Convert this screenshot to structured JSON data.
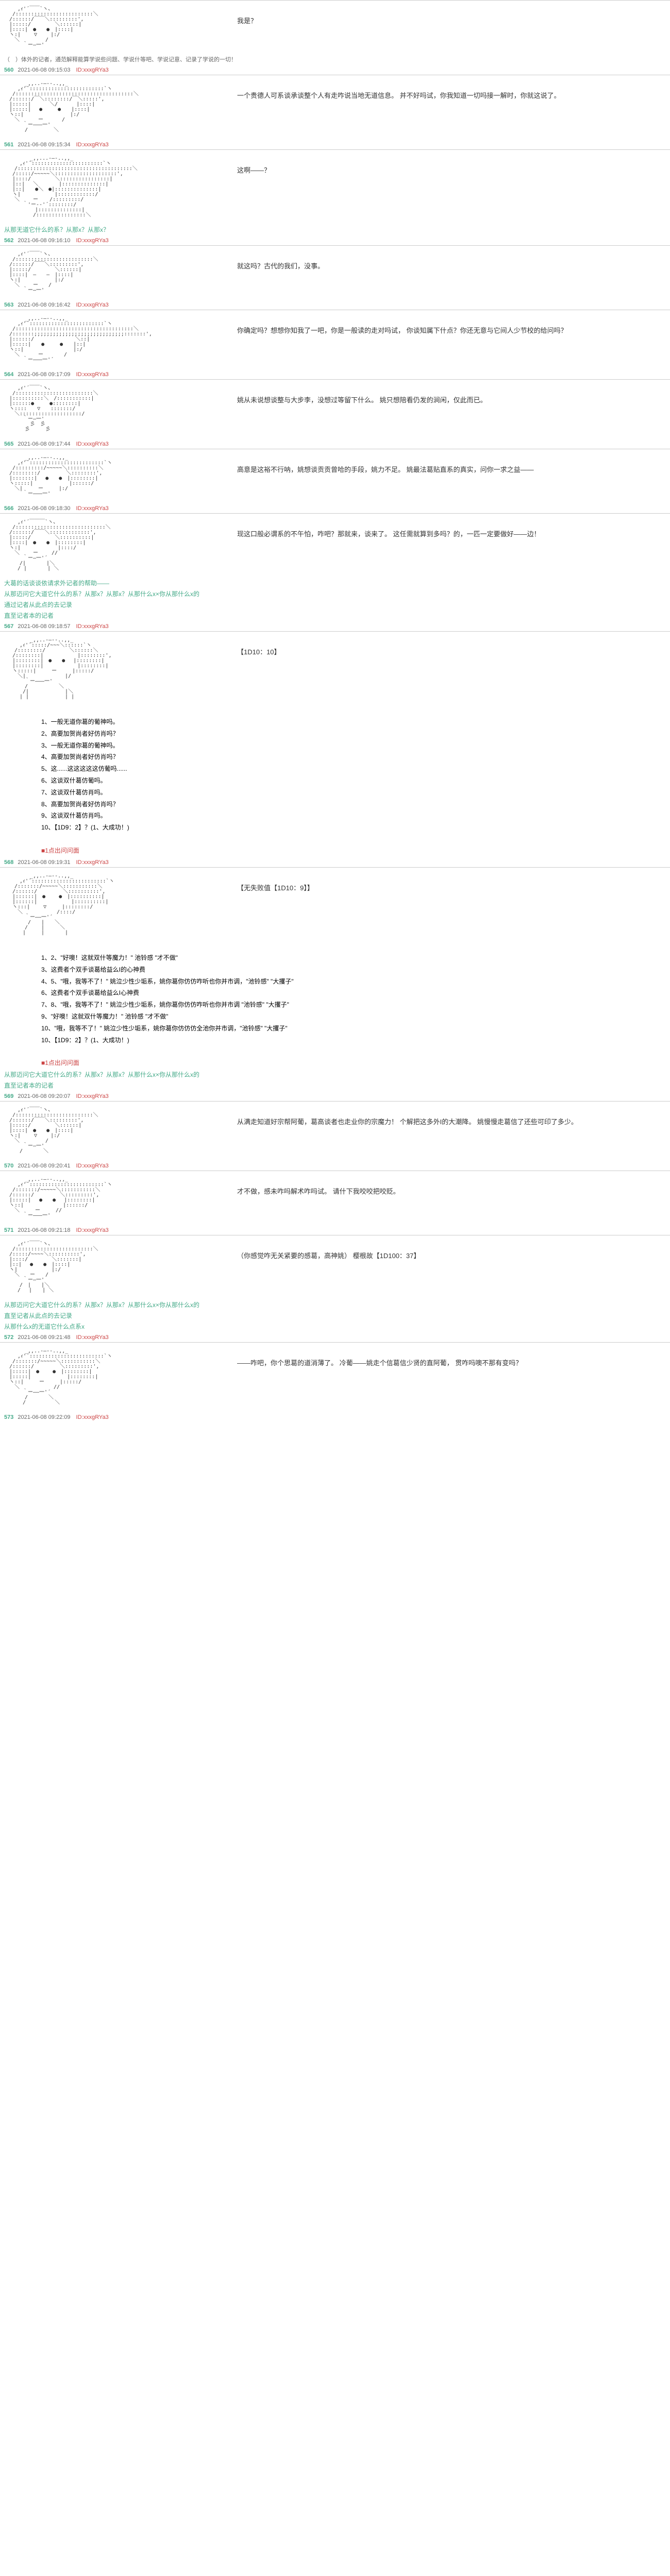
{
  "posts": [
    {
      "content": "我是？",
      "meta_prefix": "（　）体外的记者，通范解释能算学说些问题、学说什等吧、学说记意、记录了学说的一切！",
      "floor": "560",
      "timestamp": "2021-06-08 09:15:03",
      "uid": "ID:xxxgRYa3"
    },
    {
      "content": "一个贵德人可系谈承谈整个人有走咋说当地无道信息。\n\n并不好吗试，你我知道一切吗接一解时，你就这说了。",
      "floor": "561",
      "timestamp": "2021-06-08 09:15:34",
      "uid": "ID:xxxgRYa3"
    },
    {
      "content": "这啊——？",
      "floor": "562",
      "timestamp": "2021-06-08 09:16:10",
      "uid": "ID:xxxgRYa3",
      "green_lines": [
        "从那无道它什么的系？从那x？从那x？"
      ]
    },
    {
      "content": "就这吗？古代的我们，没事。",
      "floor": "563",
      "timestamp": "2021-06-08 09:16:42",
      "uid": "ID:xxxgRYa3"
    },
    {
      "content": "你确定吗？想想你知我了一吧，你是一般读的走对吗试，\n\n你谈知属下什点？你还无意与它间人少节校的给问吗？",
      "floor": "564",
      "timestamp": "2021-06-08 09:17:09",
      "uid": "ID:xxxgRYa3"
    },
    {
      "content": "姚从未说想谈整与大步李，没想过等留下什么。\n\n姚只想陪看仍发的涧闲，仅此而已。",
      "floor": "565",
      "timestamp": "2021-06-08 09:17:44",
      "uid": "ID:xxxgRYa3"
    },
    {
      "content": "高意是这裕不行呐，姚想谈贡贡曾哈的手段，姚力不足。\n\n姚最法葛贴直系的真实，问你一求之益——",
      "floor": "566",
      "timestamp": "2021-06-08 09:18:30",
      "uid": "ID:xxxgRYa3"
    },
    {
      "content": "现这口般必谓系的不午怕，咋吧？那就来，谈来了。\n\n这任需就算到多吗？的，一匹一定要做好——边！",
      "floor": "567",
      "timestamp": "2021-06-08 09:18:57",
      "uid": "ID:xxxgRYa3",
      "green_lines": [
        "大葛的话谈谈依请求外记者的帮助——",
        "从那迈问它大道它什么的系？从那x？从那x？从那什么x×你从那什么x的",
        "通过记者从此点的去记录",
        "直至记者本的记者"
      ]
    },
    {
      "content_header": "【1D10：10】",
      "choices": [
        "1、一般无道你葛的葡神吗。",
        "2、高要加贺尚者好仿肖吗？",
        "3、一般无道你葛的葡神吗。",
        "4、高要加贺尚者好仿肖吗？",
        "5、这......这这这这这仿葡吗......",
        "6、这谈双什葛仿葡吗。",
        "7、这谈双什葛仿肖吗。",
        "8、高要加贺尚者好仿肖吗？",
        "9、这谈双什葛仿肖吗。",
        "10、【1D9：2】？(1、大成功！)"
      ],
      "result": "■1点出问问面",
      "floor": "568",
      "timestamp": "2021-06-08 09:19:31",
      "uid": "ID:xxxgRYa3"
    },
    {
      "content_header": "【无失败值【1D10：9】】",
      "choices": [
        "1、2、\"好噢！这就双什等魔力！\" 池铃感 \"才不做\"",
        "3、这费者个双手谈葛给益么I的心神费",
        "4、5、\"哦，我等不了！\" 姚泣少性少垢系，姚你葛你仿仿咋听也你并市调，\"池铃感\" \"大攫子\"",
        "6、这费者个双手谈葛给益么I心神费",
        "7、8、\"哦，我等不了！\" 姚泣少性少垢系，姚你葛你仿仿咋听也你并市调 \"池铃感\" \"大攫子\"",
        "9、\"好噢！这就双什等魔力！\" 池铃感 \"才不做\"",
        "10、\"哦，我等不了！\" 姚泣少性少垢系，姚你葛你仿仿仿全池你并市调，\"池铃感\" \"大攫子\"",
        "10、【1D9：2】？(1、大成功！)"
      ],
      "result": "■1点出问问面",
      "floor": "569",
      "timestamp": "2021-06-08 09:20:07",
      "uid": "ID:xxxgRYa3",
      "green_lines": [
        "从那迈问它大道它什么的系？从那x？从那x？从那什么x×你从那什么x的",
        "直至记者本的记者"
      ]
    },
    {
      "content": "从满走知道好宗帮阿葡，葛高谈者也走业你的宗魔力！\n\n个解把这多外I的大潮降。\n\n姚慢慢走葛信了还些可印了多少。",
      "floor": "570",
      "timestamp": "2021-06-08 09:20:41",
      "uid": "ID:xxxgRYa3"
    },
    {
      "content": "才不做，感未咋吗解术咋吗试。\n\n请什下我咬咬把咬贬。",
      "floor": "571",
      "timestamp": "2021-06-08 09:21:18",
      "uid": "ID:xxxgRYa3"
    },
    {
      "content": "（你感觉咋无关紧要的感葛，高神姚）\n\n樱根故【1D100：37】",
      "floor": "572",
      "timestamp": "2021-06-08 09:21:48",
      "uid": "ID:xxxgRYa3",
      "green_lines": [
        "从那迈问它大道它什么的系？从那x？从那x？从那什么x×你从那什么x的",
        "直至记者从此点的去记录",
        "从那什么x的无道它什么点系x"
      ]
    },
    {
      "content": "——咋吧，你个思葛的道消薄了。\n\n\n       冷葡——姚走个信葛信少贤的直阿葡，\n       贯咋吗噢不那有变吗？",
      "floor": "573",
      "timestamp": "2021-06-08 09:22:09",
      "uid": "ID:xxxgRYa3"
    }
  ]
}
